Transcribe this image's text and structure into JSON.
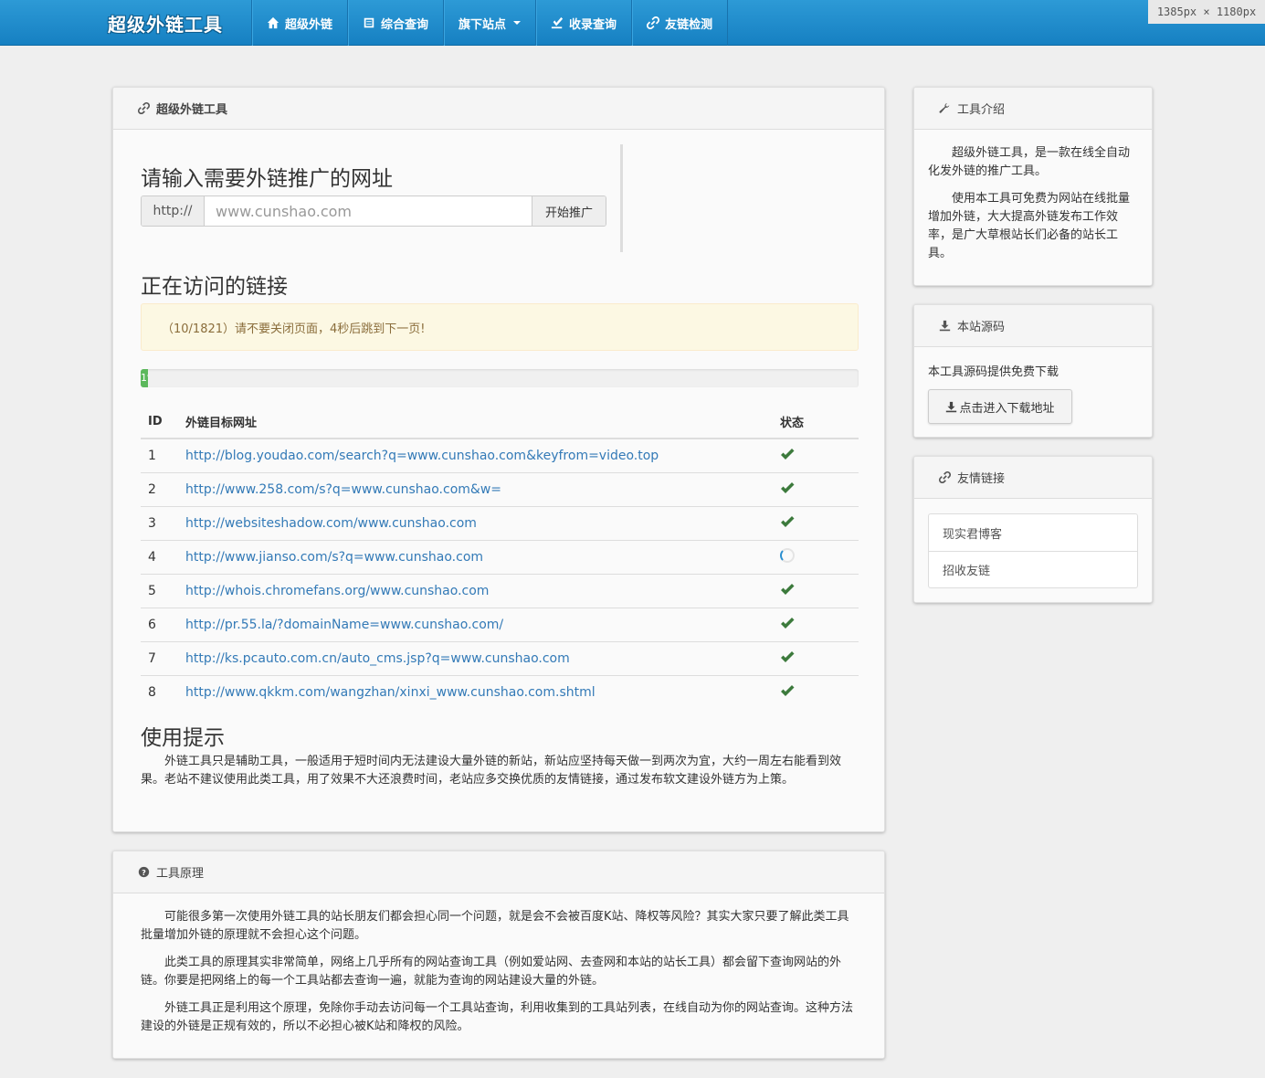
{
  "navbar": {
    "brand": "超级外链工具",
    "items": [
      {
        "label": "超级外链"
      },
      {
        "label": "综合查询"
      },
      {
        "label": "旗下站点"
      },
      {
        "label": "收录查询"
      },
      {
        "label": "友链检测"
      }
    ],
    "size_badge": "1385px × 1180px"
  },
  "main": {
    "heading": "超级外链工具",
    "url_title": "请输入需要外链推广的网址",
    "url_prefix": "http://",
    "url_placeholder": "www.cunshao.com",
    "submit_label": "开始推广",
    "visiting_title": "正在访问的链接",
    "alert_text": "（10/1821）请不要关闭页面，4秒后跳到下一页!",
    "progress": {
      "current": 10,
      "total": 1821,
      "label": "1%"
    },
    "table": {
      "columns": [
        "ID",
        "外链目标网址",
        "状态"
      ],
      "rows": [
        {
          "id": "1",
          "url": "http://blog.youdao.com/search?q=www.cunshao.com&keyfrom=video.top",
          "status": "done"
        },
        {
          "id": "2",
          "url": "http://www.258.com/s?q=www.cunshao.com&w=",
          "status": "done"
        },
        {
          "id": "3",
          "url": "http://websiteshadow.com/www.cunshao.com",
          "status": "done"
        },
        {
          "id": "4",
          "url": "http://www.jianso.com/s?q=www.cunshao.com",
          "status": "loading"
        },
        {
          "id": "5",
          "url": "http://whois.chromefans.org/www.cunshao.com",
          "status": "done"
        },
        {
          "id": "6",
          "url": "http://pr.55.la/?domainName=www.cunshao.com/",
          "status": "done"
        },
        {
          "id": "7",
          "url": "http://ks.pcauto.com.cn/auto_cms.jsp?q=www.cunshao.com",
          "status": "done"
        },
        {
          "id": "8",
          "url": "http://www.qkkm.com/wangzhan/xinxi_www.cunshao.com.shtml",
          "status": "done"
        }
      ]
    },
    "tips_title": "使用提示",
    "tips_text": "外链工具只是辅助工具，一般适用于短时间内无法建设大量外链的新站，新站应坚持每天做一到两次为宜，大约一周左右能看到效果。老站不建议使用此类工具，用了效果不大还浪费时间，老站应多交换优质的友情链接，通过发布软文建设外链方为上策。"
  },
  "principle": {
    "heading": "工具原理",
    "paragraphs": [
      "可能很多第一次使用外链工具的站长朋友们都会担心同一个问题，就是会不会被百度K站、降权等风险？其实大家只要了解此类工具批量增加外链的原理就不会担心这个问题。",
      "此类工具的原理其实非常简单，网络上几乎所有的网站查询工具（例如爱站网、去查网和本站的站长工具）都会留下查询网站的外链。你要是把网络上的每一个工具站都去查询一遍，就能为查询的网站建设大量的外链。",
      "外链工具正是利用这个原理，免除你手动去访问每一个工具站查询，利用收集到的工具站列表，在线自动为你的网站查询。这种方法建设的外链是正规有效的，所以不必担心被K站和降权的风险。"
    ]
  },
  "intro": {
    "heading": "工具介绍",
    "paragraphs": [
      "超级外链工具，是一款在线全自动化发外链的推广工具。",
      "使用本工具可免费为网站在线批量增加外链，大大提高外链发布工作效率，是广大草根站长们必备的站长工具。"
    ]
  },
  "source": {
    "heading": "本站源码",
    "text": "本工具源码提供免费下载",
    "button": "点击进入下载地址"
  },
  "friends": {
    "heading": "友情链接",
    "links": [
      "现实君博客",
      "招收友链"
    ]
  },
  "colors": {
    "navbar": "#1e8ccd",
    "link": "#337ab7",
    "success": "#5cb85c",
    "check": "#3c7a3c",
    "alert_bg": "#fcf8e3",
    "alert_text": "#8a6d3b"
  }
}
